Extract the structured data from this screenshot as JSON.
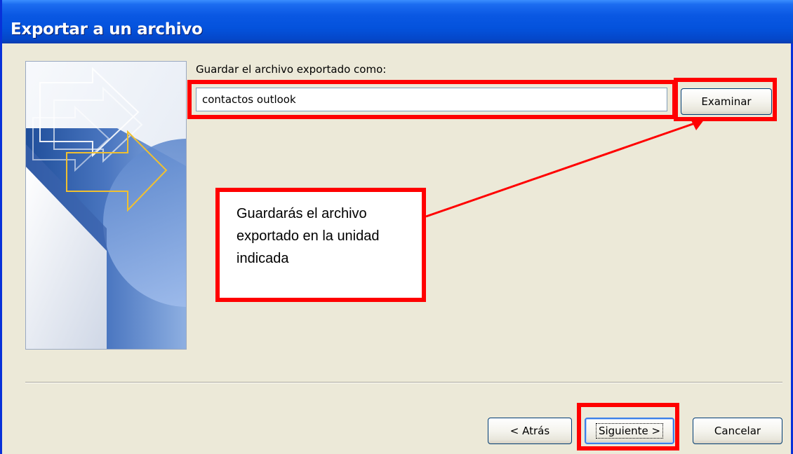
{
  "window": {
    "title": "Exportar a un archivo"
  },
  "form": {
    "save_as_label": "Guardar el archivo exportado como:",
    "filename_value": "contactos outlook",
    "browse_button": "Examinar"
  },
  "footer": {
    "back_button": "< Atrás",
    "next_button": "Siguiente >",
    "cancel_button": "Cancelar"
  },
  "annotation": {
    "callout_text": "Guardarás el archivo exportado en la unidad indicada",
    "highlight_color": "#ff0000"
  },
  "colors": {
    "titlebar": "#0452dc",
    "dialog_background": "#ece9d8",
    "wizard_gold_arrow": "#f0c030"
  }
}
